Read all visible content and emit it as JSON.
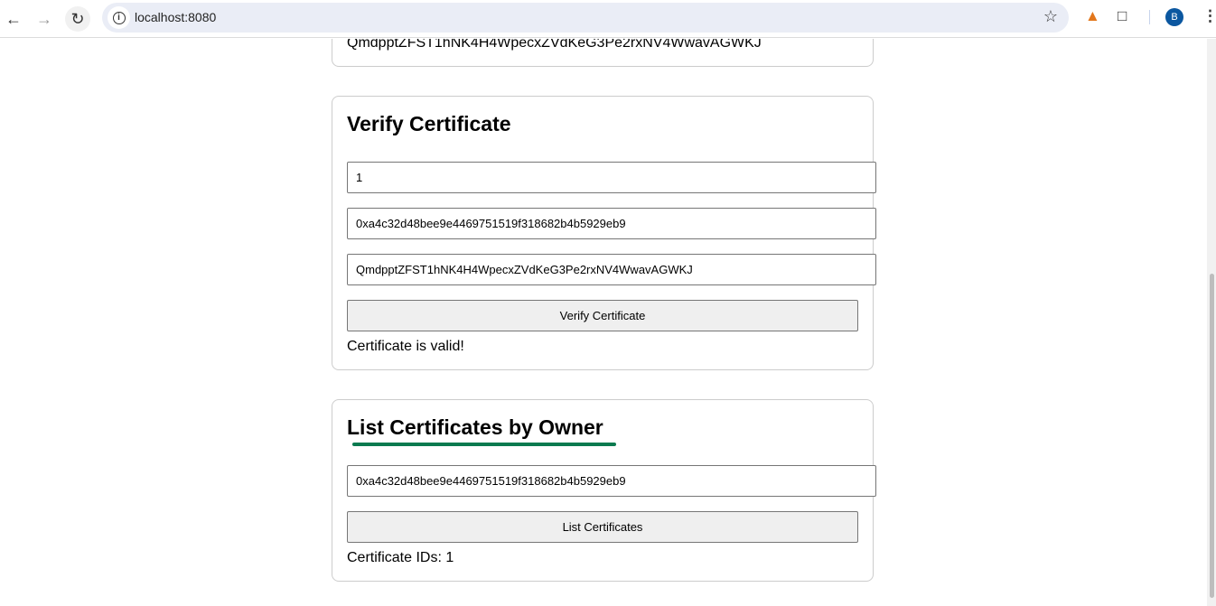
{
  "browser": {
    "url": "localhost:8080",
    "profile_initial": "B",
    "icons": [
      "back-arrow-icon",
      "forward-arrow-icon",
      "reload-icon",
      "info-icon",
      "star-icon",
      "metamask-fox-icon",
      "extensions-puzzle-icon",
      "kebab-menu-icon"
    ]
  },
  "top_card": {
    "text": "QmdpptZFST1hNK4H4WpecxZVdKeG3Pe2rxNV4WwavAGWKJ"
  },
  "verify": {
    "title": "Verify Certificate",
    "id_value": "1",
    "owner_value": "0xa4c32d48bee9e4469751519f318682b4b5929eb9",
    "hash_value": "QmdpptZFST1hNK4H4WpecxZVdKeG3Pe2rxNV4WwavAGWKJ",
    "button": "Verify Certificate",
    "result": "Certificate is valid!"
  },
  "list": {
    "title": "List Certificates by Owner",
    "owner_value": "0xa4c32d48bee9e4469751519f318682b4b5929eb9",
    "button": "List Certificates",
    "result": "Certificate IDs: 1",
    "underline_color": "#0a7a4f"
  }
}
